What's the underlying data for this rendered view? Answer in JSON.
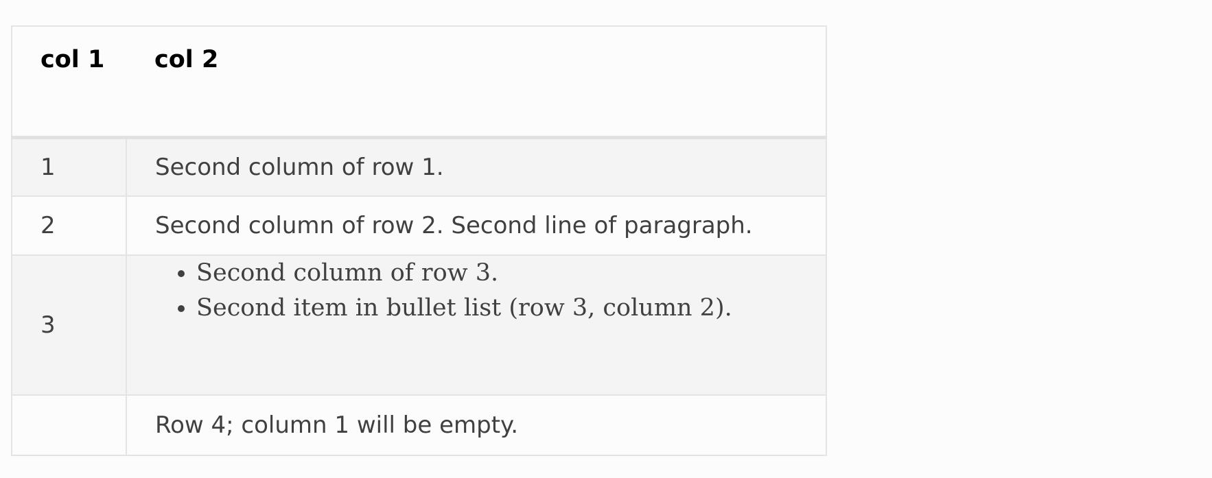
{
  "table": {
    "headers": [
      "col 1",
      "col 2"
    ],
    "rows": [
      {
        "col1": "1",
        "col2": "Second column of row 1."
      },
      {
        "col1": "2",
        "col2": "Second column of row 2. Second line of paragraph."
      },
      {
        "col1": "3",
        "col2_list": [
          "Second column of row 3.",
          "Second item in bullet list (row 3, column 2)."
        ]
      },
      {
        "col1": "",
        "col2": "Row 4; column 1 will be empty."
      }
    ]
  }
}
